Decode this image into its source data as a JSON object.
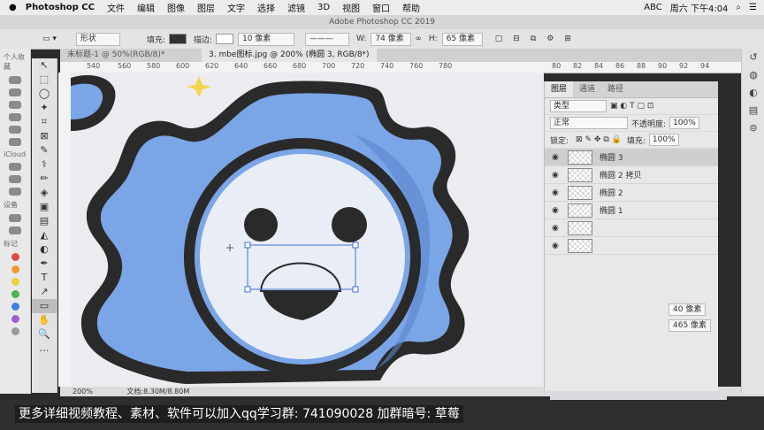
{
  "menubar": {
    "app_name": "Photoshop CC",
    "menus": [
      "文件",
      "编辑",
      "图像",
      "图层",
      "文字",
      "选择",
      "滤镜",
      "3D",
      "视图",
      "窗口",
      "帮助"
    ],
    "status": {
      "input": "ABC",
      "clock": "周六 下午4:04"
    }
  },
  "window": {
    "title": "Adobe Photoshop CC 2019"
  },
  "options": {
    "mode": "形状",
    "fill_label": "填充:",
    "stroke_label": "描边:",
    "stroke_width": "10 像素",
    "w_label": "W:",
    "w_value": "74 像素",
    "link_icon": "link-icon",
    "h_label": "H:",
    "h_value": "65 像素"
  },
  "tabs": [
    {
      "label": "未标题-1 @ 50%(RGB/8)*"
    },
    {
      "label": "3. mbe图标.jpg @ 200% (椭圆 3, RGB/8*)"
    }
  ],
  "ruler": {
    "h": [
      "540",
      "560",
      "580",
      "600",
      "620",
      "640",
      "660",
      "680",
      "700",
      "720",
      "740",
      "760",
      "780",
      "80",
      "82",
      "84",
      "86",
      "88",
      "90",
      "92",
      "94"
    ]
  },
  "sidebar": {
    "groups": [
      "个人收藏",
      "iCloud",
      "设备",
      "标记"
    ],
    "tag_colors": [
      "#e04747",
      "#f09a2e",
      "#e8d23c",
      "#4fb34f",
      "#3f7fe0",
      "#9b5fd0",
      "#9a9a9a"
    ]
  },
  "tools": [
    "↖",
    "⬚",
    "◯",
    "✦",
    "⌗",
    "⊠",
    "✎",
    "⚕",
    "✏",
    "◈",
    "▣",
    "▤",
    "◭",
    "◐",
    "✒",
    "T",
    "↗",
    "▭",
    "✋",
    "🔍",
    "…"
  ],
  "layers_panel": {
    "tabs": [
      "图层",
      "通道",
      "路径"
    ],
    "filter": "类型",
    "blend": "正常",
    "opacity_label": "不透明度:",
    "opacity": "100%",
    "lock_label": "锁定:",
    "fill_label": "填充:",
    "fill": "100%",
    "layers": [
      {
        "name": "椭圆 3",
        "selected": true
      },
      {
        "name": "椭圆 2 拷贝",
        "selected": false
      },
      {
        "name": "椭圆 2",
        "selected": false
      },
      {
        "name": "椭圆 1",
        "selected": false
      }
    ]
  },
  "properties": {
    "w_value": "40 像素",
    "h_value": "465 像素"
  },
  "status": {
    "zoom": "200%",
    "doc": "文档:8.30M/8.80M"
  },
  "subtitle": "更多详细视频教程、素材、软件可以加入qq学习群: 741090028 加群暗号: 草莓",
  "colors": {
    "icon_blue": "#7aa5e6",
    "icon_dark": "#2a2a2a",
    "accent_yellow": "#f2d648"
  }
}
